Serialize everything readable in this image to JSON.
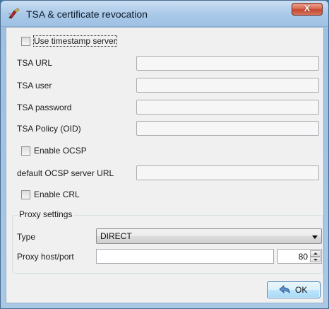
{
  "window": {
    "title": "TSA & certificate revocation",
    "close_glyph": "X",
    "icon": "pen-nib-icon"
  },
  "form": {
    "use_timestamp_server": {
      "label": "Use timestamp server",
      "checked": false
    },
    "tsa_url": {
      "label": "TSA URL",
      "value": ""
    },
    "tsa_user": {
      "label": "TSA user",
      "value": ""
    },
    "tsa_password": {
      "label": "TSA password",
      "value": ""
    },
    "tsa_policy": {
      "label": "TSA Policy (OID)",
      "value": ""
    },
    "enable_ocsp": {
      "label": "Enable OCSP",
      "checked": false
    },
    "ocsp_url": {
      "label": "default OCSP server URL",
      "value": ""
    },
    "enable_crl": {
      "label": "Enable CRL",
      "checked": false
    }
  },
  "proxy": {
    "group_title": "Proxy settings",
    "type_label": "Type",
    "type_value": "DIRECT",
    "host_label": "Proxy host/port",
    "host_value": "",
    "port_value": "80"
  },
  "buttons": {
    "ok_label": "OK",
    "ok_icon": "undo-arrow-icon"
  },
  "colors": {
    "title_bar": "#a9c8e8",
    "close_button": "#c54832",
    "client_background": "#f0f0f0",
    "ok_button": "#bee6fd"
  }
}
